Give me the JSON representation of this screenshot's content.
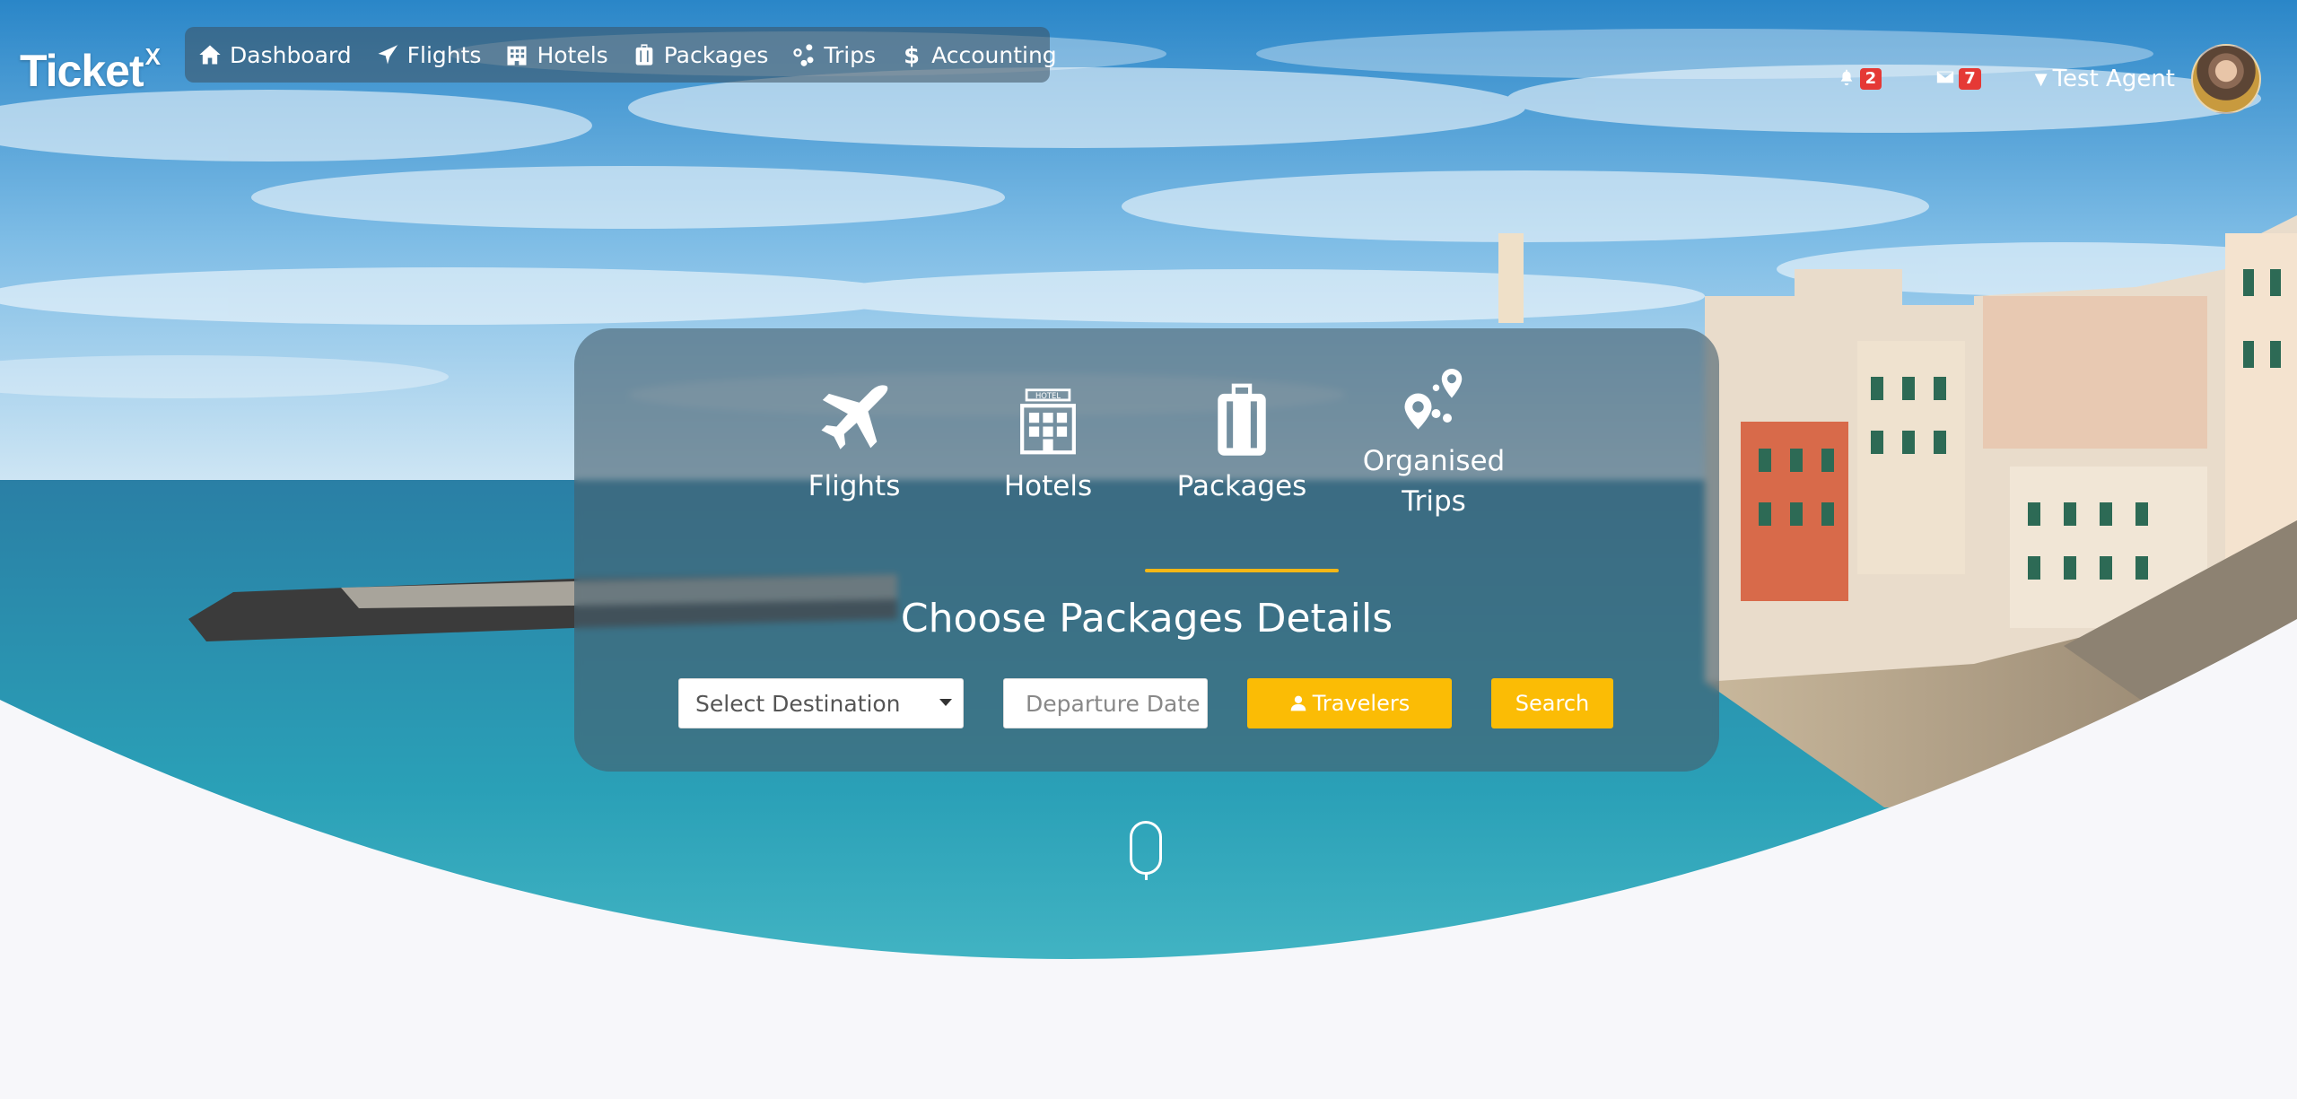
{
  "brand": {
    "name": "Ticket",
    "sup": "X"
  },
  "nav": {
    "items": [
      {
        "label": "Dashboard",
        "icon": "home-icon"
      },
      {
        "label": "Flights",
        "icon": "plane-icon"
      },
      {
        "label": "Hotels",
        "icon": "hotel-icon"
      },
      {
        "label": "Packages",
        "icon": "luggage-icon"
      },
      {
        "label": "Trips",
        "icon": "trips-icon"
      },
      {
        "label": "Accounting",
        "icon": "dollar-icon"
      }
    ]
  },
  "notifications": {
    "bell_count": "2",
    "mail_count": "7"
  },
  "user": {
    "name": "Test Agent"
  },
  "tabs": [
    {
      "label": "Flights",
      "icon": "plane-icon"
    },
    {
      "label": "Hotels",
      "icon": "hotel-icon",
      "icon_text": "HOTEL"
    },
    {
      "label": "Packages",
      "icon": "luggage-icon",
      "active": true
    },
    {
      "label": "Organised Trips",
      "label_line1": "Organised",
      "label_line2": "Trips",
      "icon": "map-pins-icon"
    }
  ],
  "search": {
    "title": "Choose Packages Details",
    "destination_placeholder": "Select Destination",
    "date_placeholder": "Departure Date",
    "travelers_label": "Travelers",
    "search_label": "Search"
  },
  "colors": {
    "accent": "#fbbc05",
    "badge": "#e53935",
    "underline": "#f5b715"
  }
}
